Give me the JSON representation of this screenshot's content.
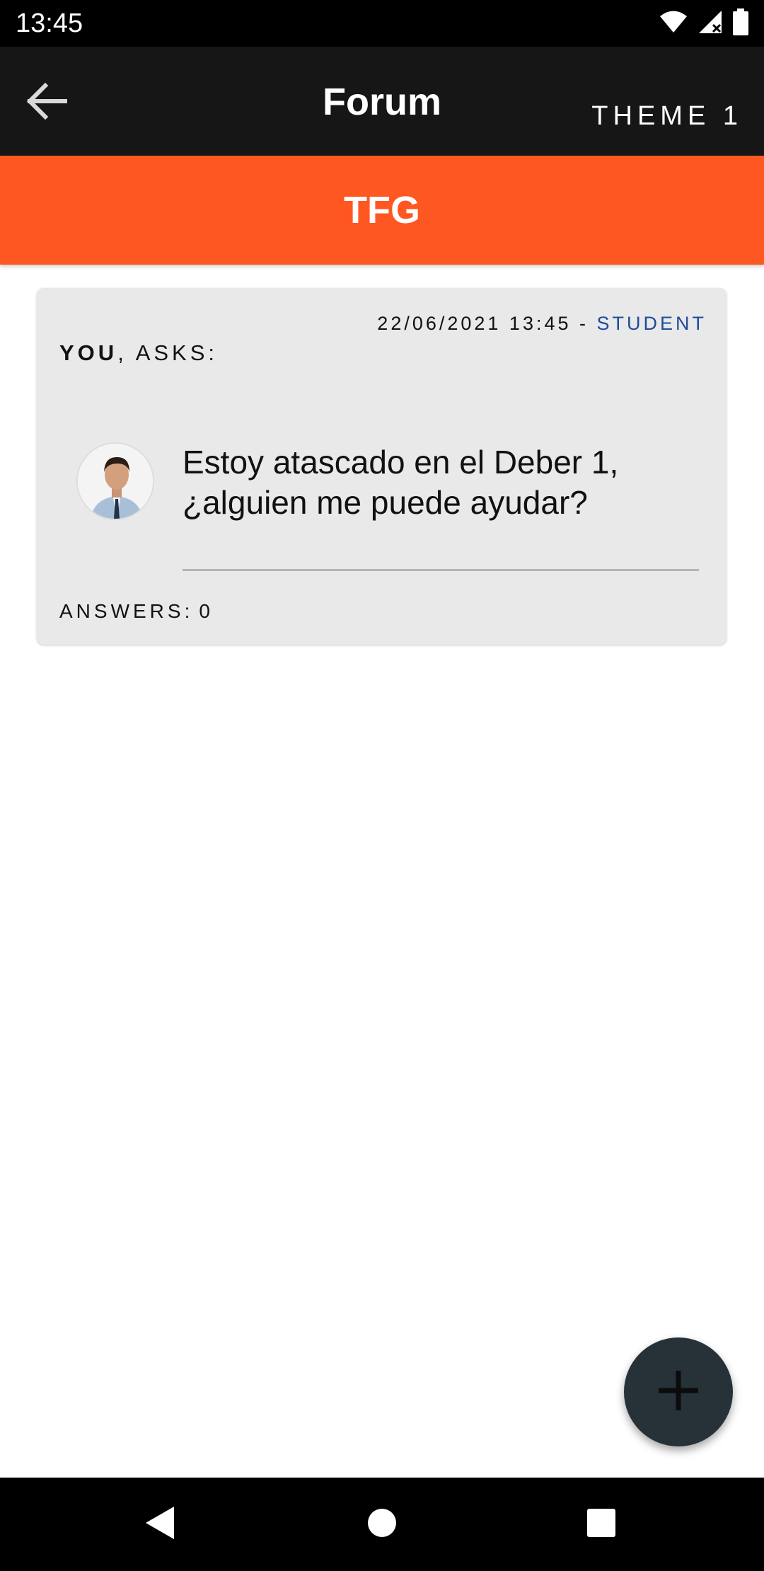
{
  "status_bar": {
    "time": "13:45",
    "icons": [
      "wifi-icon",
      "cell-signal-icon",
      "battery-icon"
    ]
  },
  "app_bar": {
    "back_icon": "arrow-left-icon",
    "title": "Forum",
    "theme_button": "THEME 1"
  },
  "course": {
    "name": "TFG",
    "color": "#ff5722"
  },
  "posts": [
    {
      "datetime": "22/06/2021 13:45",
      "separator": " - ",
      "role": "STUDENT",
      "author": "YOU",
      "action": ", ASKS:",
      "body": "Estoy atascado en el Deber 1, ¿alguien me puede ayudar?",
      "answers_label": "ANSWERS:",
      "answers_count": "0"
    }
  ],
  "fab": {
    "icon": "plus-icon"
  },
  "nav_bar": {
    "icons": [
      "back-triangle-icon",
      "home-circle-icon",
      "recents-square-icon"
    ]
  },
  "colors": {
    "app_bar": "#161616",
    "accent": "#ff5722",
    "role": "#1e4c9a",
    "card": "#e9e9e9",
    "fab": "#263238"
  }
}
